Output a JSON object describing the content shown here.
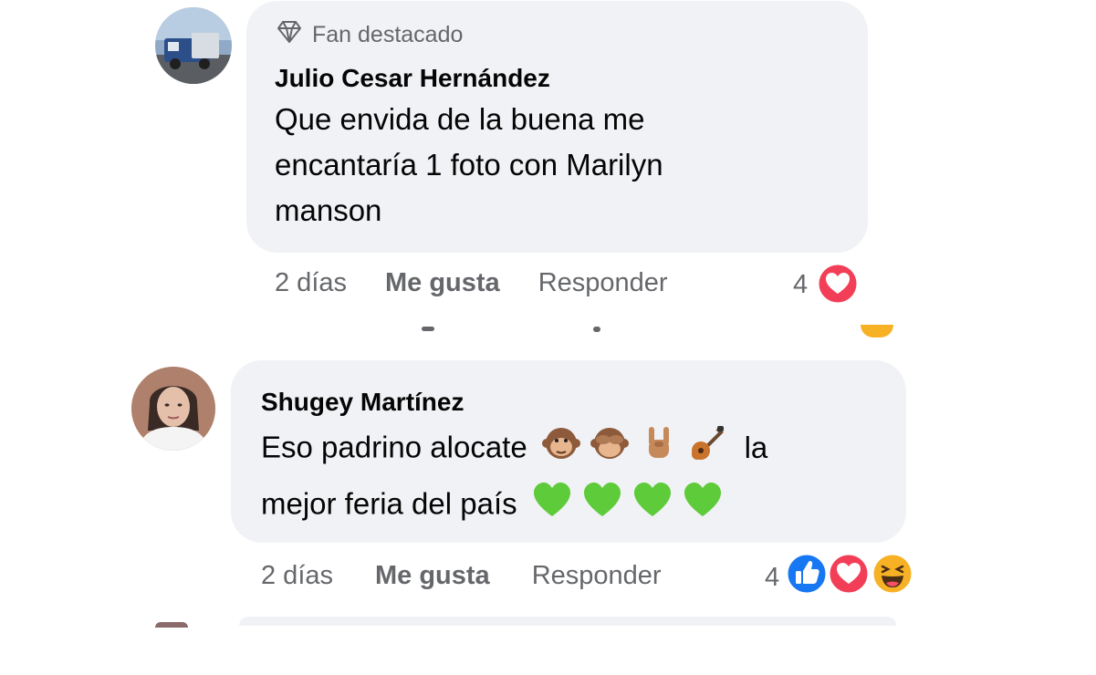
{
  "comments": [
    {
      "badge": "Fan destacado",
      "author": "Julio Cesar Hernández",
      "text_lines": [
        "Que envida de la buena me",
        "encantaría 1 foto con Marilyn",
        "manson"
      ],
      "time": "2 días",
      "like_label": "Me gusta",
      "reply_label": "Responder",
      "reaction_count": "4",
      "reactions": [
        "love-reaction-icon"
      ]
    },
    {
      "author": "Shugey Martínez",
      "text_line1": "Eso padrino alocate",
      "text_line1_end": "la",
      "text_line2": "mejor feria del país",
      "emojis_line1": [
        "monkey-emoji",
        "see-no-evil-monkey-emoji",
        "sign-of-horns-emoji",
        "guitar-emoji"
      ],
      "emojis_line2": [
        "green-heart-emoji",
        "green-heart-emoji",
        "green-heart-emoji",
        "green-heart-emoji"
      ],
      "time": "2 días",
      "like_label": "Me gusta",
      "reply_label": "Responder",
      "reaction_count": "4",
      "reactions": [
        "like-reaction-icon",
        "love-reaction-icon",
        "haha-reaction-icon"
      ]
    }
  ],
  "colors": {
    "bubble": "#f0f2f5",
    "meta_text": "#65676b",
    "love": "#f33e58",
    "like": "#1877f2",
    "haha": "#f7b125",
    "green_heart": "#5ecb3a"
  }
}
